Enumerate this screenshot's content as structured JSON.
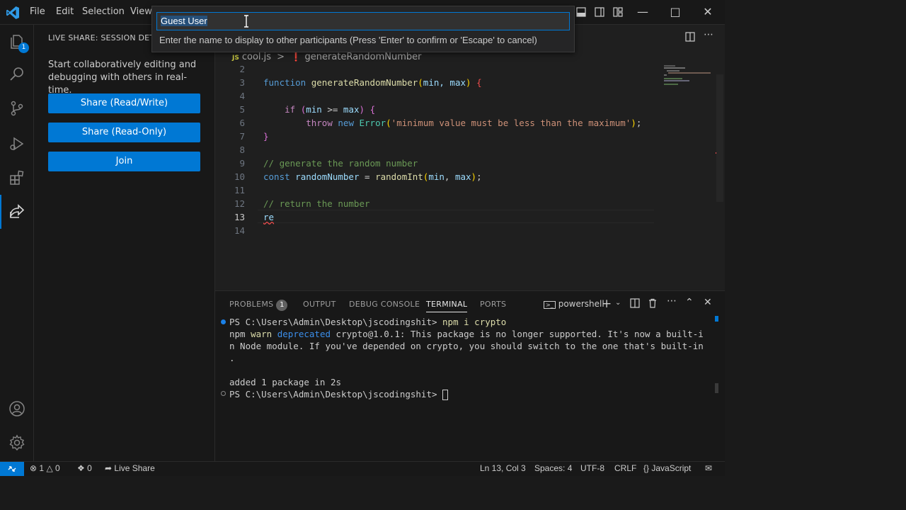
{
  "menu": {
    "file": "File",
    "edit": "Edit",
    "selection": "Selection",
    "view": "View"
  },
  "quick_input": {
    "value": "Guest User",
    "message": "Enter the name to display to other participants (Press 'Enter' to confirm or 'Escape' to cancel)"
  },
  "activity": {
    "explorer_badge": "1"
  },
  "sidebar": {
    "title": "LIVE SHARE: SESSION DETAILS",
    "description": "Start collaboratively editing and debugging with others in real-time.",
    "buttons": {
      "share_rw": "Share (Read/Write)",
      "share_ro": "Share (Read-Only)",
      "join": "Join"
    }
  },
  "editor": {
    "breadcrumb": {
      "file_icon": "JS",
      "file": "cool.js",
      "separator": ">",
      "symbol": "generateRandomNumber"
    },
    "line_numbers": [
      "2",
      "3",
      "4",
      "5",
      "6",
      "7",
      "8",
      "9",
      "10",
      "11",
      "12",
      "13",
      "14"
    ],
    "current_line": "13",
    "code": {
      "l3_kw": "function",
      "l3_fn": "generateRandomNumber",
      "l3_params": "min, max",
      "l5_if": "if",
      "l5_min": "min",
      "l5_op": " >= ",
      "l5_max": "max",
      "l6_throw": "throw",
      "l6_new": "new",
      "l6_type": "Error",
      "l6_str": "'minimum value must be less than the maximum'",
      "l9_comment": "// generate the random number",
      "l10_const": "const",
      "l10_var": "randomNumber",
      "l10_fn": "randomInt",
      "l10_min": "min",
      "l10_max": "max",
      "l12_comment": "// return the number",
      "l13_text": "re"
    }
  },
  "panel": {
    "tabs": {
      "problems": "PROBLEMS",
      "problems_count": "1",
      "output": "OUTPUT",
      "debug": "DEBUG CONSOLE",
      "terminal": "TERMINAL",
      "ports": "PORTS"
    },
    "shell": "powershell",
    "terminal": {
      "prompt1": "PS C:\\Users\\Admin\\Desktop\\jscodingshit>",
      "cmd1": " npm i crypto",
      "warn_npm": "npm",
      "warn_word": "warn",
      "warn_dep": "deprecated",
      "warn_rest": " crypto@1.0.1: This package is no longer supported. It's now a built-i",
      "warn_line2": "n Node module. If you've depended on crypto, you should switch to the one that's built-in",
      "warn_line3": ".",
      "added": "added 1 package in 2s",
      "prompt2": "PS C:\\Users\\Admin\\Desktop\\jscodingshit>"
    }
  },
  "statusbar": {
    "errors": "1",
    "warnings": "0",
    "ports": "0",
    "live_share": "Live Share",
    "position": "Ln 13, Col 3",
    "spaces": "Spaces: 4",
    "encoding": "UTF-8",
    "eol": "CRLF",
    "language_braces": "{}",
    "language": "JavaScript"
  },
  "colors": {
    "accent": "#0078d4",
    "background": "#1f1f1f",
    "sidebar": "#181818"
  }
}
